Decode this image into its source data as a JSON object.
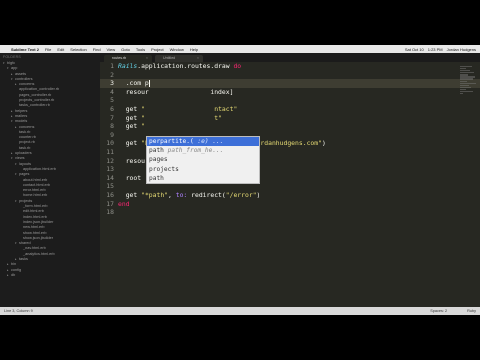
{
  "menubar": {
    "apple": "",
    "items": [
      "Sublime Text 2",
      "File",
      "Edit",
      "Selection",
      "Find",
      "View",
      "Goto",
      "Tools",
      "Project",
      "Window",
      "Help"
    ],
    "right": [
      "Sat Oct 10",
      "1:23 PM",
      "Jordan Hudgens"
    ]
  },
  "sidebar": {
    "header": "FOLDERS",
    "tree": [
      {
        "label": "blgfc",
        "depth": 0,
        "open": true
      },
      {
        "label": "app",
        "depth": 1,
        "open": true
      },
      {
        "label": "assets",
        "depth": 2,
        "open": false
      },
      {
        "label": "controllers",
        "depth": 2,
        "open": true
      },
      {
        "label": "concerns",
        "depth": 3,
        "open": false
      },
      {
        "label": "application_controller.rb",
        "depth": 3
      },
      {
        "label": "pages_controller.rb",
        "depth": 3
      },
      {
        "label": "projects_controller.rb",
        "depth": 3
      },
      {
        "label": "tasks_controller.rb",
        "depth": 3
      },
      {
        "label": "helpers",
        "depth": 2,
        "open": false
      },
      {
        "label": "mailers",
        "depth": 2,
        "open": false
      },
      {
        "label": "models",
        "depth": 2,
        "open": true
      },
      {
        "label": "concerns",
        "depth": 3,
        "open": false
      },
      {
        "label": "task.rb",
        "depth": 3
      },
      {
        "label": "counter.rb",
        "depth": 3
      },
      {
        "label": "project.rb",
        "depth": 3
      },
      {
        "label": "task.rb",
        "depth": 3
      },
      {
        "label": "uploaders",
        "depth": 2,
        "open": false
      },
      {
        "label": "views",
        "depth": 2,
        "open": true
      },
      {
        "label": "layouts",
        "depth": 3,
        "open": true
      },
      {
        "label": "application.html.erb",
        "depth": 4
      },
      {
        "label": "pages",
        "depth": 3,
        "open": true
      },
      {
        "label": "about.html.erb",
        "depth": 4
      },
      {
        "label": "contact.html.erb",
        "depth": 4
      },
      {
        "label": "error.html.erb",
        "depth": 4
      },
      {
        "label": "home.html.erb",
        "depth": 4
      },
      {
        "label": "projects",
        "depth": 3,
        "open": true
      },
      {
        "label": "_form.html.erb",
        "depth": 4
      },
      {
        "label": "edit.html.erb",
        "depth": 4
      },
      {
        "label": "index.html.erb",
        "depth": 4
      },
      {
        "label": "index.json.jbuilder",
        "depth": 4
      },
      {
        "label": "new.html.erb",
        "depth": 4
      },
      {
        "label": "show.html.erb",
        "depth": 4
      },
      {
        "label": "show.json.jbuilder",
        "depth": 4
      },
      {
        "label": "shared",
        "depth": 3,
        "open": true
      },
      {
        "label": "_nav.html.erb",
        "depth": 4
      },
      {
        "label": "_analytics.html.erb",
        "depth": 4
      },
      {
        "label": "tasks",
        "depth": 3,
        "open": false
      },
      {
        "label": "bin",
        "depth": 1,
        "open": false
      },
      {
        "label": "config",
        "depth": 1,
        "open": false
      },
      {
        "label": "db",
        "depth": 1,
        "open": false
      }
    ]
  },
  "tabs": [
    {
      "label": "routes.rb",
      "active": true
    },
    {
      "label": "Untitled",
      "active": false
    }
  ],
  "editor": {
    "lines": [
      {
        "n": "1",
        "tokens": [
          {
            "t": "Rails",
            "c": "t-const"
          },
          {
            "t": ".application.routes.draw ",
            "c": ""
          },
          {
            "t": "do",
            "c": "t-kw"
          }
        ]
      },
      {
        "n": "2",
        "tokens": []
      },
      {
        "n": "3",
        "tokens": [
          {
            "t": "  .com p",
            "c": ""
          }
        ],
        "cursor": true
      },
      {
        "n": "4",
        "tokens": [
          {
            "t": "  resour",
            "c": ""
          },
          {
            "t": "                ",
            "c": ""
          },
          {
            "t": "index]",
            "c": ""
          }
        ]
      },
      {
        "n": "5",
        "tokens": []
      },
      {
        "n": "6",
        "tokens": [
          {
            "t": "  get ",
            "c": ""
          },
          {
            "t": "\"",
            "c": "t-str"
          },
          {
            "t": "                  ",
            "c": ""
          },
          {
            "t": "ntact\"",
            "c": "t-str"
          }
        ]
      },
      {
        "n": "7",
        "tokens": [
          {
            "t": "  get ",
            "c": ""
          },
          {
            "t": "\"",
            "c": "t-str"
          },
          {
            "t": "                  ",
            "c": ""
          },
          {
            "t": "t\"",
            "c": "t-str"
          }
        ]
      },
      {
        "n": "8",
        "tokens": [
          {
            "t": "  get ",
            "c": ""
          },
          {
            "t": "\"",
            "c": "t-str"
          }
        ]
      },
      {
        "n": "9",
        "tokens": []
      },
      {
        "n": "10",
        "tokens": [
          {
            "t": "  get ",
            "c": ""
          },
          {
            "t": "\"blog\"",
            "c": "t-str"
          },
          {
            "t": ", ",
            "c": ""
          },
          {
            "t": "to:",
            "c": "t-sym"
          },
          {
            "t": " redirect(",
            "c": ""
          },
          {
            "t": "\"http://jordanhudgens.com\"",
            "c": "t-str"
          },
          {
            "t": ")",
            "c": ""
          }
        ]
      },
      {
        "n": "11",
        "tokens": []
      },
      {
        "n": "12",
        "tokens": [
          {
            "t": "  resources ",
            "c": ""
          },
          {
            "t": ":projects",
            "c": "t-sym"
          }
        ]
      },
      {
        "n": "13",
        "tokens": []
      },
      {
        "n": "14",
        "tokens": [
          {
            "t": "  root ",
            "c": ""
          },
          {
            "t": "'pages#home'",
            "c": "t-str"
          }
        ]
      },
      {
        "n": "15",
        "tokens": []
      },
      {
        "n": "16",
        "tokens": [
          {
            "t": "  get ",
            "c": ""
          },
          {
            "t": "\"*path\"",
            "c": "t-str"
          },
          {
            "t": ", ",
            "c": ""
          },
          {
            "t": "to:",
            "c": "t-sym"
          },
          {
            "t": " redirect(",
            "c": ""
          },
          {
            "t": "\"/error\"",
            "c": "t-str"
          },
          {
            "t": ")",
            "c": ""
          }
        ]
      },
      {
        "n": "17",
        "tokens": [
          {
            "t": "end",
            "c": "t-kw"
          }
        ]
      },
      {
        "n": "18",
        "tokens": []
      }
    ],
    "active_line": 2
  },
  "autocomplete": {
    "items": [
      {
        "name": "perpartite.(",
        "hint": " :e) ...  ",
        "selected": true
      },
      {
        "name": "path",
        "hint": " path_from_he...",
        "selected": false
      },
      {
        "name": "pages",
        "hint": "",
        "selected": false
      },
      {
        "name": "projects",
        "hint": "",
        "selected": false
      },
      {
        "name": "path",
        "hint": "",
        "selected": false
      }
    ]
  },
  "status": {
    "left": "Line 3, Column 9",
    "right": [
      "Spaces: 2",
      "Ruby"
    ]
  },
  "colors": {
    "editor_bg": "#272822",
    "selection": "#3d6fd8",
    "keyword": "#f92672",
    "string": "#e6db74",
    "symbol": "#ae81ff",
    "constant": "#66d9ef"
  }
}
